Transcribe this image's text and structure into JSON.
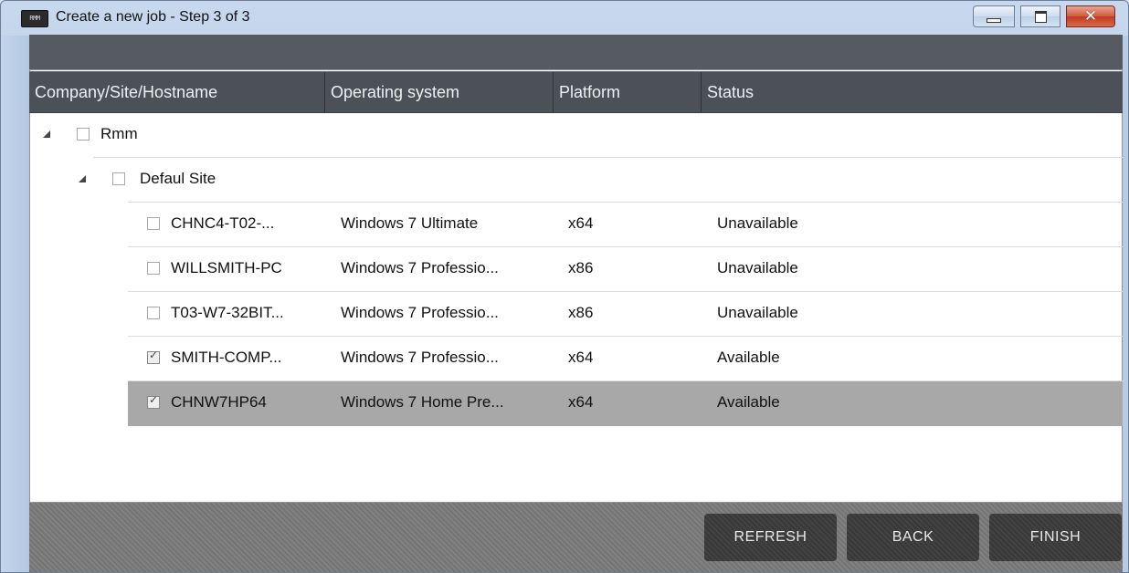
{
  "window": {
    "title": "Create a new job - Step 3 of 3",
    "app_icon_text": "RMM",
    "close_glyph": "✕"
  },
  "table": {
    "columns": [
      "Company/Site/Hostname",
      "Operating system",
      "Platform",
      "Status"
    ],
    "company": {
      "name": "Rmm",
      "checked": false,
      "expanded": true
    },
    "site": {
      "name": "Defaul Site",
      "checked": false,
      "expanded": true
    },
    "hosts": [
      {
        "hostname": "CHNC4-T02-...",
        "os": "Windows 7 Ultimate",
        "platform": "x64",
        "status": "Unavailable",
        "checked": false,
        "selected": false
      },
      {
        "hostname": "WILLSMITH-PC",
        "os": "Windows 7 Professio...",
        "platform": "x86",
        "status": "Unavailable",
        "checked": false,
        "selected": false
      },
      {
        "hostname": "T03-W7-32BIT...",
        "os": "Windows 7 Professio...",
        "platform": "x86",
        "status": "Unavailable",
        "checked": false,
        "selected": false
      },
      {
        "hostname": "SMITH-COMP...",
        "os": "Windows 7 Professio...",
        "platform": "x64",
        "status": "Available",
        "checked": true,
        "selected": false
      },
      {
        "hostname": "CHNW7HP64",
        "os": "Windows 7 Home Pre...",
        "platform": "x64",
        "status": "Available",
        "checked": true,
        "selected": true
      }
    ]
  },
  "footer": {
    "refresh_label": "REFRESH",
    "back_label": "BACK",
    "finish_label": "FINISH"
  }
}
